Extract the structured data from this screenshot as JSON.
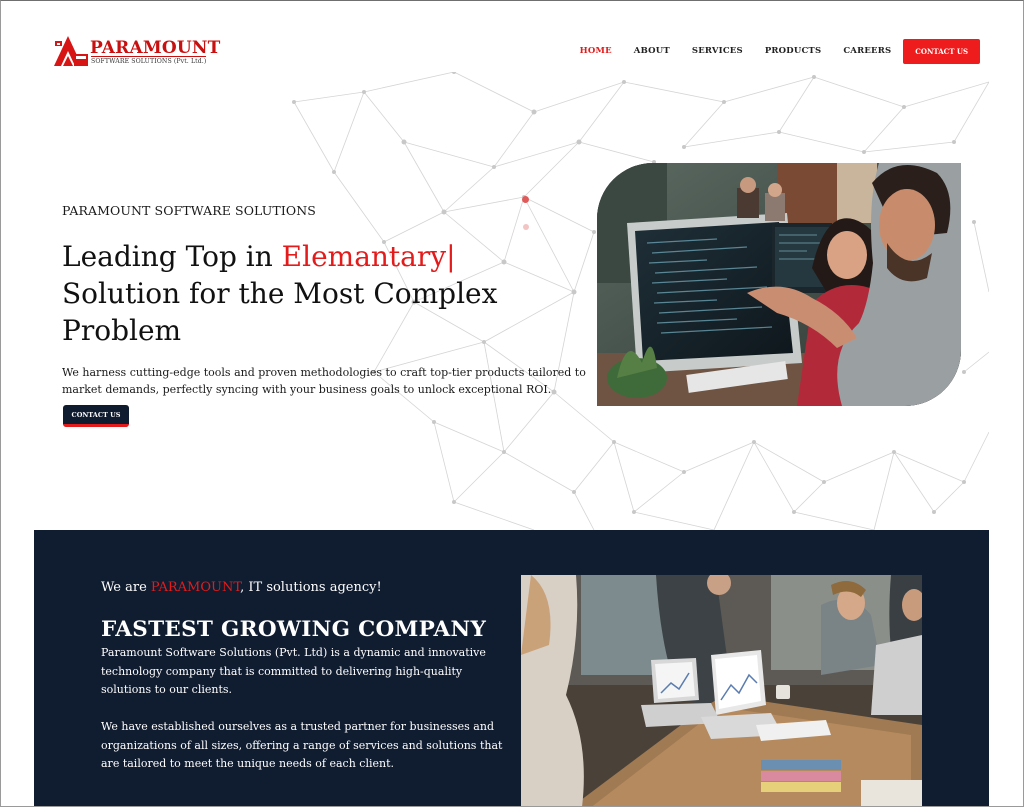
{
  "brand": {
    "name": "PARAMOUNT",
    "tagline": "SOFTWARE SOLUTIONS (Pvt. Ltd.)",
    "accent_color": "#e31b1b",
    "dark_color": "#101c30"
  },
  "nav": {
    "items": [
      {
        "label": "HOME",
        "active": true
      },
      {
        "label": "ABOUT",
        "active": false
      },
      {
        "label": "SERVICES",
        "active": false
      },
      {
        "label": "PRODUCTS",
        "active": false
      },
      {
        "label": "CAREERS",
        "active": false
      }
    ],
    "cta_label": "CONTACT US"
  },
  "hero": {
    "kicker": "PARAMOUNT SOFTWARE SOLUTIONS",
    "title_prefix": "Leading Top in ",
    "title_highlight": "Elemantary|",
    "title_rest": "Solution for the Most Complex Problem",
    "description": "We harness cutting-edge tools and proven methodologies to craft top-tier products tailored to market demands, perfectly syncing with your business goals to unlock exceptional ROI.",
    "cta_label": "CONTACT US",
    "image_icon": "developers-at-computers-photo"
  },
  "about": {
    "kicker_prefix": "We are ",
    "kicker_brand": "PARAMOUNT",
    "kicker_suffix": ", IT solutions agency!",
    "title": "FASTEST GROWING COMPANY",
    "paragraph_1": "Paramount Software Solutions (Pvt. Ltd) is a dynamic and innovative technology company that is committed to delivering high-quality solutions to our clients.",
    "paragraph_2": "We have established ourselves as a trusted partner for businesses and organizations of all sizes, offering a range of services and solutions that are tailored to meet the unique needs of each client.",
    "image_icon": "team-meeting-photo"
  }
}
